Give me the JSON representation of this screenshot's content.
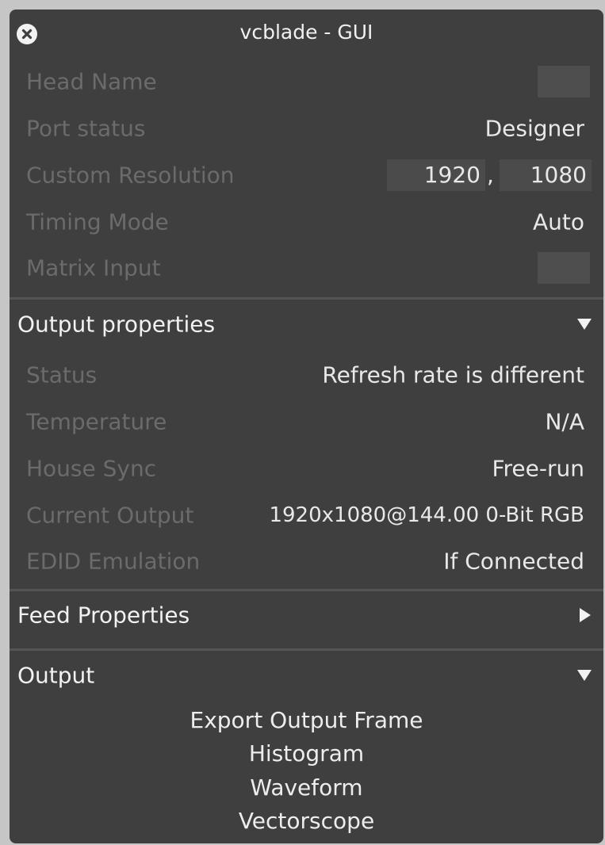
{
  "window": {
    "title": "vcblade - GUI",
    "close_icon": "close-circle-icon"
  },
  "head": {
    "head_name_label": "Head Name",
    "port_status_label": "Port status",
    "port_status_value": "Designer",
    "custom_resolution_label": "Custom Resolution",
    "resolution_width": "1920",
    "resolution_separator": ",",
    "resolution_height": "1080",
    "timing_mode_label": "Timing Mode",
    "timing_mode_value": "Auto",
    "matrix_input_label": "Matrix Input"
  },
  "output_properties": {
    "title": "Output properties",
    "expanded": true,
    "arrow_icon": "triangle-down-icon",
    "status_label": "Status",
    "status_value": "Refresh rate is different",
    "temperature_label": "Temperature",
    "temperature_value": "N/A",
    "house_sync_label": "House Sync",
    "house_sync_value": "Free-run",
    "current_output_label": "Current Output",
    "current_output_value": "1920x1080@144.00 0-Bit  RGB",
    "edid_label": "EDID Emulation",
    "edid_value": "If Connected"
  },
  "feed_properties": {
    "title": "Feed Properties",
    "expanded": false,
    "arrow_icon": "triangle-right-icon"
  },
  "output": {
    "title": "Output",
    "expanded": true,
    "arrow_icon": "triangle-down-icon",
    "actions": [
      "Export Output Frame",
      "Histogram",
      "Waveform",
      "Vectorscope"
    ]
  },
  "colors": {
    "background": "#c6c6c6",
    "panel": "#3f3f3f",
    "label_text": "#6b6b6b",
    "value_text": "#e8e8e8",
    "field": "#4b4b4b"
  }
}
